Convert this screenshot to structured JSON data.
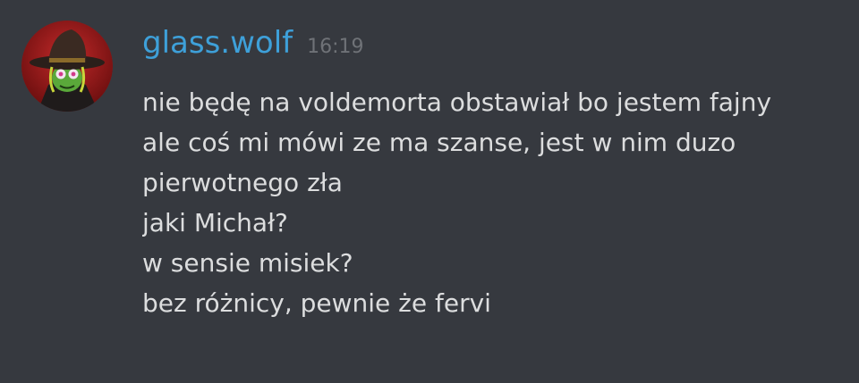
{
  "message": {
    "author": "glass.wolf",
    "timestamp": "16:19",
    "avatar_icon": "witch-hat-character-avatar",
    "lines": [
      "nie będę na voldemorta obstawiał bo jestem fajny",
      "ale coś mi mówi ze ma szanse, jest w nim duzo",
      "pierwotnego zła",
      "jaki Michał?",
      "w sensie misiek?",
      "bez różnicy, pewnie że fervi"
    ]
  },
  "colors": {
    "background": "#36393f",
    "username": "#3ea0d9",
    "timestamp": "#6f7277",
    "message_text": "#dcddde"
  }
}
